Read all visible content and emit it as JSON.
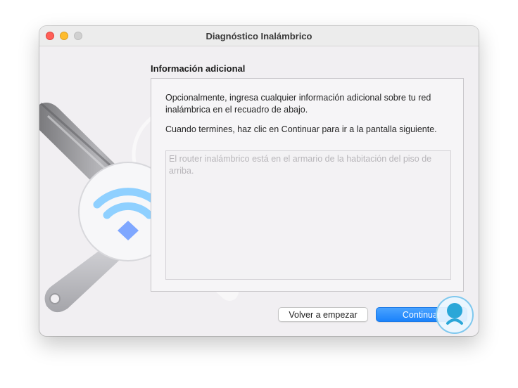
{
  "window": {
    "title": "Diagnóstico Inalámbrico"
  },
  "section": {
    "heading": "Información adicional",
    "paragraph1": "Opcionalmente, ingresa cualquier información adicional sobre tu red inalámbrica en el recuadro de abajo.",
    "paragraph2": "Cuando termines, haz clic en Continuar para ir a la pantalla siguiente.",
    "textarea_placeholder": "El router inalámbrico está en el armario de la habitación del piso de arriba."
  },
  "buttons": {
    "reset_label": "Volver a empezar",
    "continue_label": "Continuar"
  },
  "icons": {
    "illustration": "wireless-diagnostics-wrench-icon",
    "wifi": "wifi-icon",
    "badge": "site-watermark-icon"
  },
  "colors": {
    "accent": "#1a82fb",
    "wifi": "#8fd0ff"
  }
}
